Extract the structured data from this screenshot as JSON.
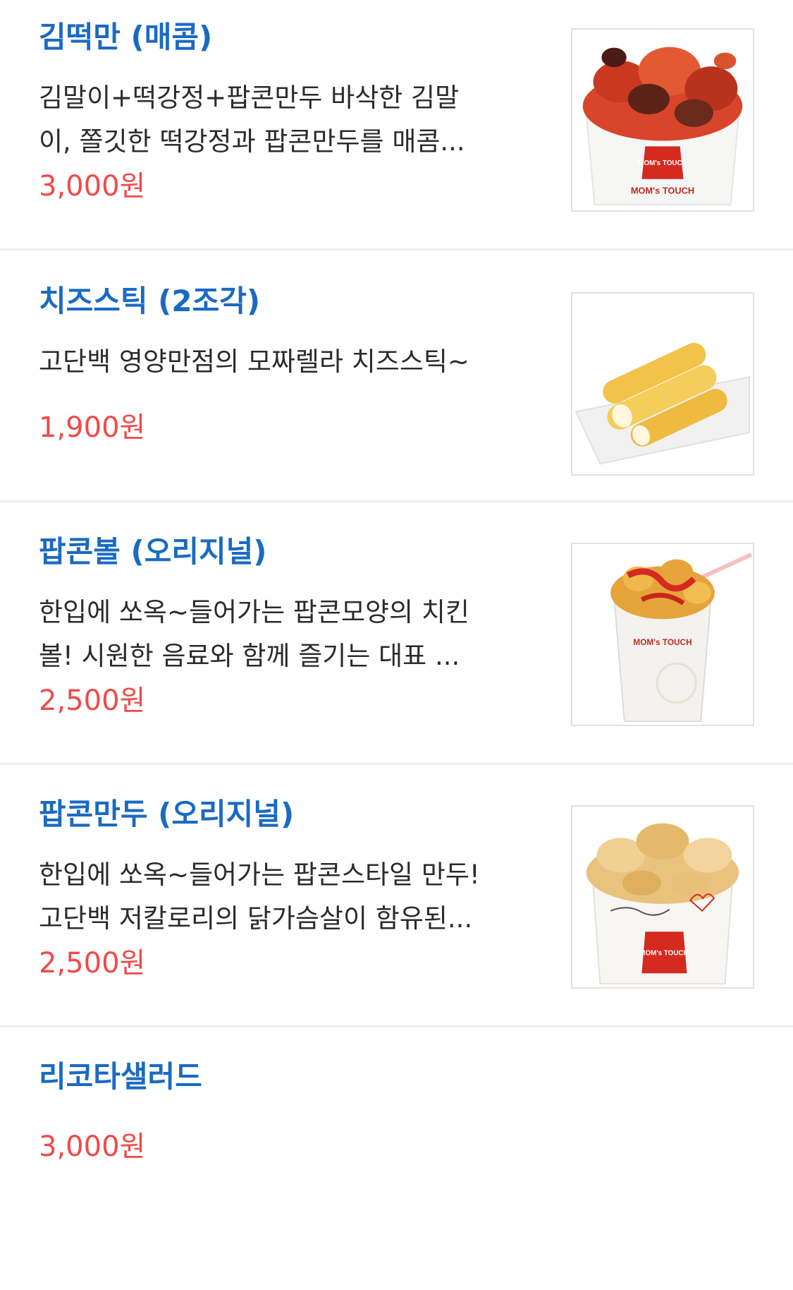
{
  "items": [
    {
      "name": "김떡만 (매콤)",
      "description": "김말이+떡강정+팝콘만두 바삭한 김말\n이, 쫄깃한 떡강정과 팝콘만두를 매콤...",
      "price": "3,000원",
      "image": "spicy-snack-box-photo",
      "logo_text": "MOM's TOUCH"
    },
    {
      "name": "치즈스틱 (2조각)",
      "description": "고단백 영양만점의 모짜렐라 치즈스틱~",
      "price": "1,900원",
      "image": "cheese-stick-photo"
    },
    {
      "name": "팝콘볼 (오리지널)",
      "description": "한입에 쏘옥~들어가는 팝콘모양의 치킨\n볼! 시원한 음료와 함께 즐기는 대표 ...",
      "price": "2,500원",
      "image": "popcorn-chicken-cup-photo",
      "logo_text": "MOM's TOUCH"
    },
    {
      "name": "팝콘만두 (오리지널)",
      "description": "한입에 쏘옥~들어가는 팝콘스타일 만두!\n고단백 저칼로리의 닭가슴살이 함유된...",
      "price": "2,500원",
      "image": "popcorn-dumpling-box-photo",
      "logo_text": "MOM's TOUCH"
    },
    {
      "name": "리코타샐러드",
      "description": "",
      "price": "3,000원"
    }
  ],
  "colors": {
    "name": "#1a6ac2",
    "price": "#f04a49",
    "description": "#2b2b2b",
    "divider": "#eeeeee"
  }
}
